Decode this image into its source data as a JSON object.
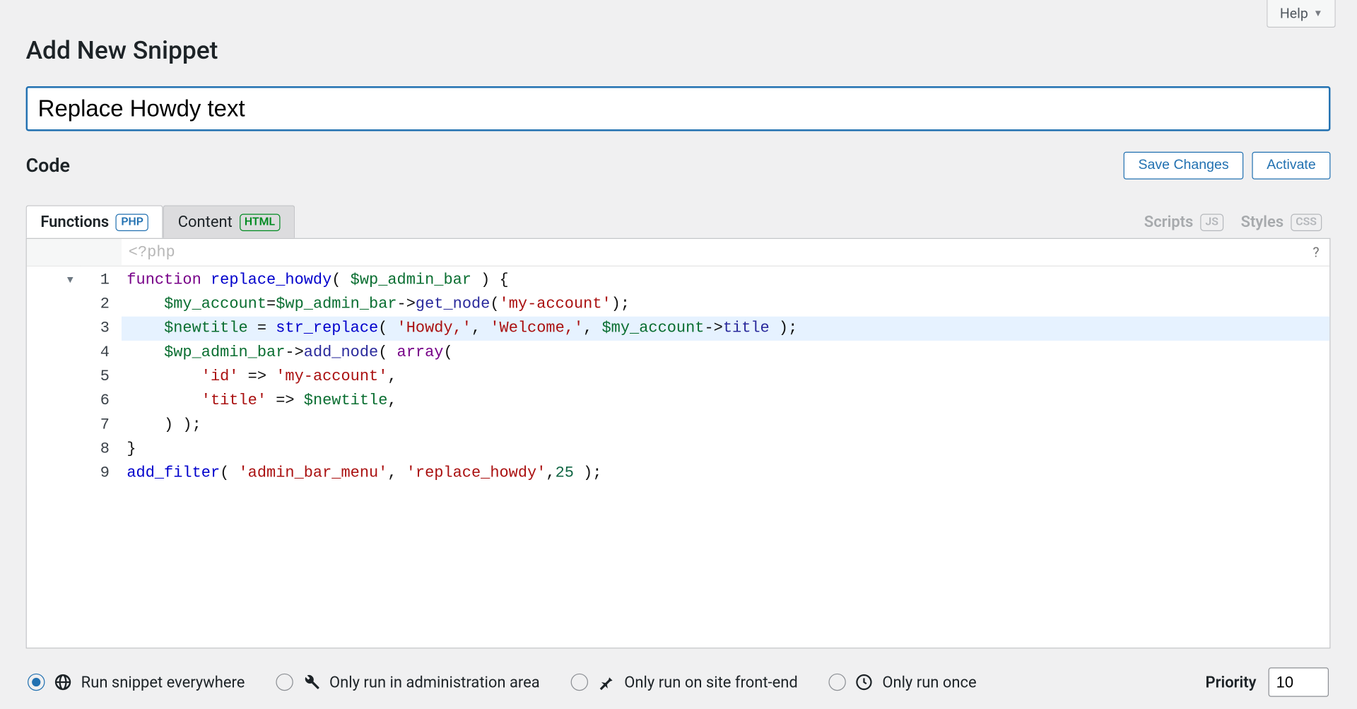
{
  "help_label": "Help",
  "page_title": "Add New Snippet",
  "snippet_title": "Replace Howdy text",
  "code_heading": "Code",
  "buttons": {
    "save": "Save Changes",
    "activate": "Activate"
  },
  "tabs": {
    "functions": {
      "label": "Functions",
      "badge": "PHP"
    },
    "content": {
      "label": "Content",
      "badge": "HTML"
    },
    "scripts": {
      "label": "Scripts",
      "badge": "JS"
    },
    "styles": {
      "label": "Styles",
      "badge": "CSS"
    }
  },
  "editor": {
    "placeholder_hint": "<?php",
    "help_hint": "?",
    "fold_marker": "▼",
    "highlighted_line": 3,
    "line_numbers": [
      "1",
      "2",
      "3",
      "4",
      "5",
      "6",
      "7",
      "8",
      "9"
    ],
    "code": {
      "l1": {
        "kw": "function",
        "name": "replace_howdy",
        "arg": "$wp_admin_bar"
      },
      "l2": {
        "var": "$my_account",
        "rhs_var": "$wp_admin_bar",
        "method": "get_node",
        "arg": "'my-account'"
      },
      "l3": {
        "var": "$newtitle",
        "fn": "str_replace",
        "a": "'Howdy,'",
        "b": "'Welcome,'",
        "c_var": "$my_account",
        "c_prop": "title"
      },
      "l4": {
        "var": "$wp_admin_bar",
        "method": "add_node",
        "kw": "array"
      },
      "l5": {
        "key": "'id'",
        "val": "'my-account'"
      },
      "l6": {
        "key": "'title'",
        "val_var": "$newtitle"
      },
      "l7": {
        "txt": "    ) );"
      },
      "l8": {
        "txt": "}"
      },
      "l9": {
        "fn": "add_filter",
        "a": "'admin_bar_menu'",
        "b": "'replace_howdy'",
        "num": "25"
      }
    }
  },
  "run_options": {
    "everywhere": "Run snippet everywhere",
    "admin": "Only run in administration area",
    "frontend": "Only run on site front-end",
    "once": "Only run once",
    "selected": "everywhere"
  },
  "priority": {
    "label": "Priority",
    "value": "10"
  }
}
